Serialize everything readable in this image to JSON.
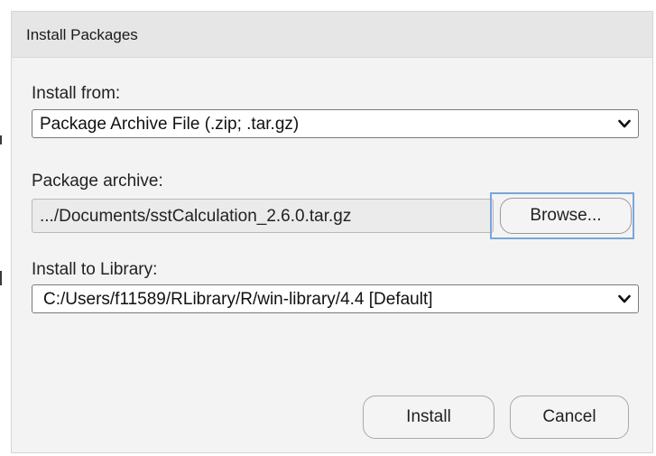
{
  "dialog": {
    "title": "Install Packages"
  },
  "install_from": {
    "label": "Install from:",
    "selected": "Package Archive File (.zip; .tar.gz)"
  },
  "package_archive": {
    "label": "Package archive:",
    "value": ".../Documents/sstCalculation_2.6.0.tar.gz",
    "browse_label": "Browse..."
  },
  "install_to_library": {
    "label": "Install to Library:",
    "selected": "C:/Users/f11589/RLibrary/R/win-library/4.4 [Default]"
  },
  "buttons": {
    "install_label": "Install",
    "cancel_label": "Cancel"
  },
  "icons": {
    "dropdown": "chevron-down-icon"
  },
  "colors": {
    "dialog_bg": "#f3f3f3",
    "titlebar_bg": "#e6e6e6",
    "focus_ring": "#7aa6d8"
  }
}
